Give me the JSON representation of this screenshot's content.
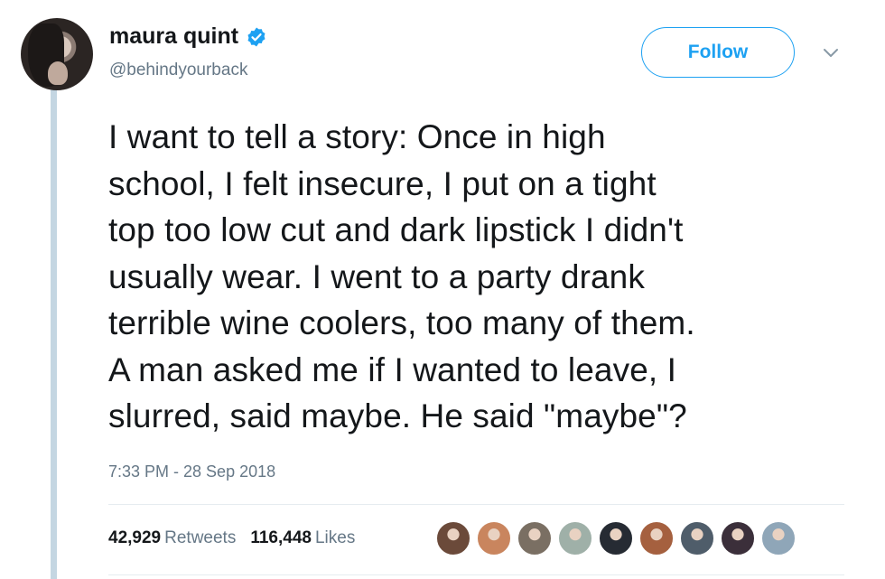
{
  "author": {
    "name": "maura quint",
    "handle": "@behindyourback",
    "verified": true,
    "avatar_icon": "profile-photo"
  },
  "follow_label": "Follow",
  "tweet": {
    "text": "I want to tell a story: Once in high\nschool, I felt insecure, I put on a tight\ntop too low cut and dark lipstick I didn't\nusually wear. I went to a party drank\nterrible wine coolers, too many of them.\nA man asked me if I wanted to leave, I\nslurred, said maybe. He said \"maybe\"?",
    "timestamp": "7:33 PM - 28 Sep 2018"
  },
  "stats": {
    "retweets_count": "42,929",
    "retweets_label": "Retweets",
    "likes_count": "116,448",
    "likes_label": "Likes"
  },
  "likers": [
    {
      "color": "#6b4a3a"
    },
    {
      "color": "#c9855e"
    },
    {
      "color": "#7a6f63"
    },
    {
      "color": "#9fb0a8"
    },
    {
      "color": "#262b33"
    },
    {
      "color": "#a5603f"
    },
    {
      "color": "#4f5d6a"
    },
    {
      "color": "#3b2f3a"
    },
    {
      "color": "#8fa6b8"
    }
  ],
  "colors": {
    "accent": "#1da1f2",
    "muted": "#657786",
    "thread_line": "#c4d6e2"
  }
}
